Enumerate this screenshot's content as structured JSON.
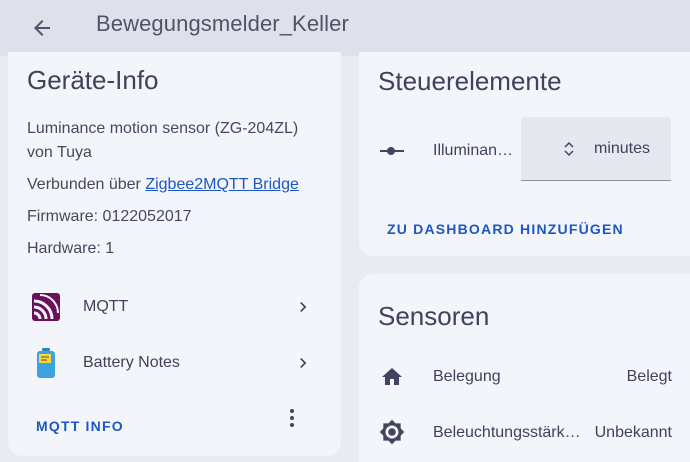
{
  "header": {
    "title": "Bewegungsmelder_Keller"
  },
  "device_info": {
    "title": "Geräte-Info",
    "model_line": "Luminance motion sensor (ZG-204ZL)",
    "manufacturer_line": "von Tuya",
    "connected_prefix": "Verbunden über ",
    "connected_link": "Zigbee2MQTT Bridge",
    "firmware": "Firmware: 0122052017",
    "hardware": "Hardware: 1",
    "integrations": [
      {
        "label": "MQTT",
        "icon": "mqtt-icon"
      },
      {
        "label": "Battery Notes",
        "icon": "battery-notes-icon"
      }
    ],
    "mqtt_info_button": "MQTT INFO"
  },
  "controls": {
    "title": "Steuerelemente",
    "entity_label": "Illuminan…",
    "entity_icon": "slider-icon",
    "unit": "minutes",
    "value": "",
    "add_to_dashboard": "ZU DASHBOARD HINZUFÜGEN"
  },
  "sensors": {
    "title": "Sensoren",
    "items": [
      {
        "label": "Belegung",
        "value": "Belegt",
        "icon": "home-icon"
      },
      {
        "label": "Beleuchtungsstärk…",
        "value": "Unbekannt",
        "icon": "brightness-icon"
      }
    ]
  },
  "colors": {
    "accent": "#1c57c3",
    "mqtt_icon": "#6a0f5c",
    "battery_icon": "#3aa3e0",
    "background": "#e9ebf3",
    "card": "#f4f5fa"
  }
}
